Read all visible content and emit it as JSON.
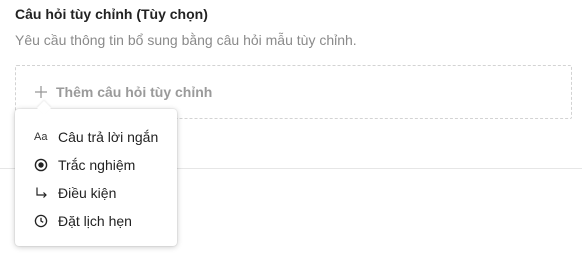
{
  "section": {
    "title": "Câu hỏi tùy chỉnh (Tùy chọn)",
    "description": "Yêu cầu thông tin bổ sung bằng câu hỏi mẫu tùy chỉnh."
  },
  "add_button": {
    "label": "Thêm câu hỏi tùy chỉnh",
    "icon": "plus-icon"
  },
  "dropdown": {
    "items": [
      {
        "label": "Câu trả lời ngắn",
        "icon": "short-answer-icon",
        "icon_text": "Aa"
      },
      {
        "label": "Trắc nghiệm",
        "icon": "radio-icon"
      },
      {
        "label": "Điều kiện",
        "icon": "conditional-arrow-icon"
      },
      {
        "label": "Đặt lịch hẹn",
        "icon": "clock-icon"
      }
    ]
  },
  "colors": {
    "title": "#222222",
    "muted": "#8a8a8a",
    "add_label": "#9a9a9a",
    "dashed_border": "#d3d3d3",
    "divider": "#e6e6e6"
  }
}
